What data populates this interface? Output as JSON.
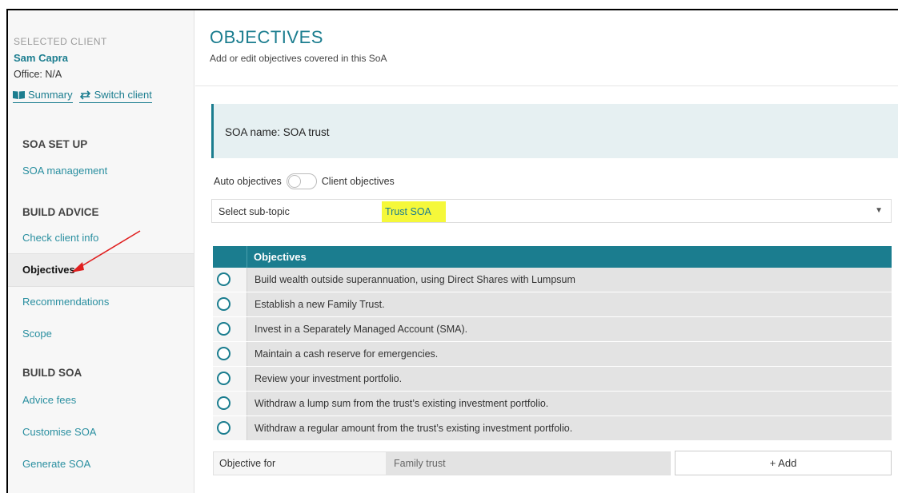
{
  "sidebar": {
    "selected_client_label": "SELECTED CLIENT",
    "client_name": "Sam Capra",
    "office": "Office: N/A",
    "summary_link": "Summary",
    "switch_link": "Switch client",
    "sections": [
      {
        "title": "SOA SET UP",
        "items": [
          "SOA management"
        ]
      },
      {
        "title": "BUILD ADVICE",
        "items": [
          "Check client info",
          "Objectives",
          "Recommendations",
          "Scope"
        ]
      },
      {
        "title": "BUILD SOA",
        "items": [
          "Advice fees",
          "Customise SOA",
          "Generate SOA"
        ]
      }
    ],
    "active_item": "Objectives"
  },
  "main": {
    "title": "OBJECTIVES",
    "subtitle": "Add or edit objectives covered in this SoA",
    "soa_name": "SOA name: SOA trust",
    "toggle": {
      "left_label": "Auto objectives",
      "right_label": "Client objectives"
    },
    "sub_topic": {
      "label": "Select sub-topic",
      "value": "Trust SOA"
    },
    "table": {
      "header": "Objectives",
      "rows": [
        "Build wealth outside superannuation, using Direct Shares with Lumpsum",
        "Establish a new Family Trust.",
        "Invest in a Separately Managed Account (SMA).",
        "Maintain a cash reserve for emergencies.",
        "Review your investment portfolio.",
        "Withdraw a lump sum from the trust’s existing investment portfolio.",
        "Withdraw a regular amount from the trust’s existing investment portfolio."
      ]
    },
    "objective_for": {
      "label": "Objective for",
      "value": "Family trust"
    },
    "add_button": "+ Add"
  },
  "colors": {
    "accent": "#1b7d8f",
    "highlight": "#f5f83a",
    "annotation_arrow": "#e02020"
  }
}
